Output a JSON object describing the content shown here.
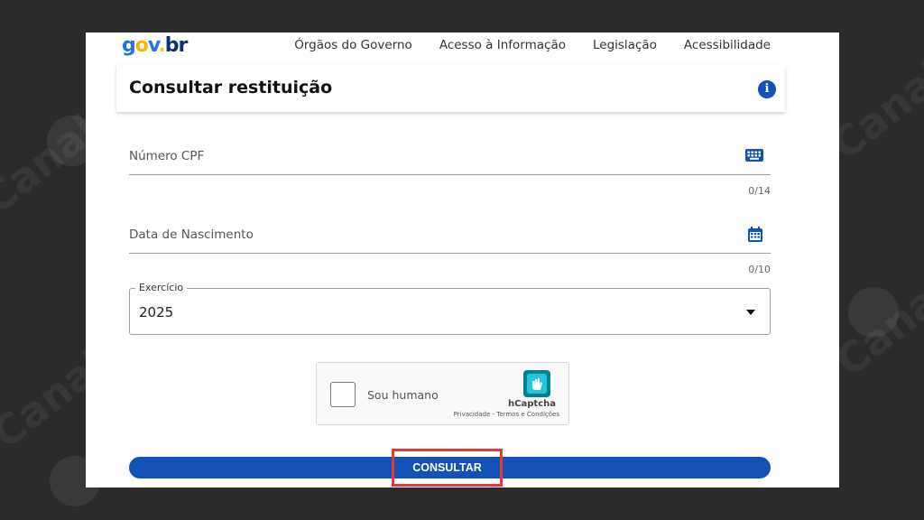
{
  "header": {
    "logo": {
      "g": "g",
      "o": "o",
      "v": "v",
      "dot": ".",
      "b": "b",
      "r": "r"
    },
    "nav": [
      "Órgãos do Governo",
      "Acesso à Informação",
      "Legislação",
      "Acessibilidade"
    ]
  },
  "card": {
    "title": "Consultar restituição",
    "info_icon": "i"
  },
  "form": {
    "cpf": {
      "label": "Número CPF",
      "counter": "0/14",
      "icon": "keyboard-icon"
    },
    "birth": {
      "label": "Data de Nascimento",
      "counter": "0/10",
      "icon": "calendar-icon"
    },
    "exercise": {
      "legend": "Exercício",
      "value": "2025"
    },
    "captcha": {
      "label": "Sou humano",
      "brand": "hCaptcha",
      "links": "Privacidade - Termos e Condições"
    },
    "submit": "CONSULTAR"
  },
  "watermark": {
    "text": "Canaltech"
  },
  "colors": {
    "primary": "#1351b4",
    "highlight": "#e53935"
  }
}
